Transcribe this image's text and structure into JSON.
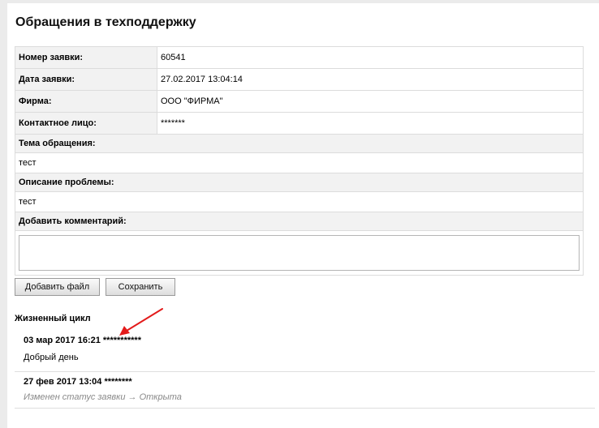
{
  "page": {
    "title": "Обращения в техподдержку"
  },
  "form": {
    "fields": [
      {
        "label": "Номер заявки:",
        "value": "60541"
      },
      {
        "label": "Дата заявки:",
        "value": "27.02.2017 13:04:14"
      },
      {
        "label": "Фирма:",
        "value": "ООО \"ФИРМА\""
      },
      {
        "label": "Контактное лицо:",
        "value": "*******"
      }
    ],
    "subject_label": "Тема обращения:",
    "subject_value": "тест",
    "description_label": "Описание проблемы:",
    "description_value": "тест",
    "comment_label": "Добавить комментарий:",
    "comment_value": ""
  },
  "buttons": {
    "add_file": "Добавить файл",
    "save": "Сохранить"
  },
  "lifecycle": {
    "title": "Жизненный цикл",
    "entries": [
      {
        "datetime": "03 мар 2017 16:21",
        "author": "***********",
        "text": "Добрый день"
      },
      {
        "datetime": "27 фев 2017 13:04",
        "author": "********",
        "text": "Изменен статус заявки → Открыта"
      }
    ]
  },
  "colors": {
    "annotation_arrow": "#e31b1b",
    "label_bg": "#f2f2f2",
    "border": "#dcdcdc"
  }
}
